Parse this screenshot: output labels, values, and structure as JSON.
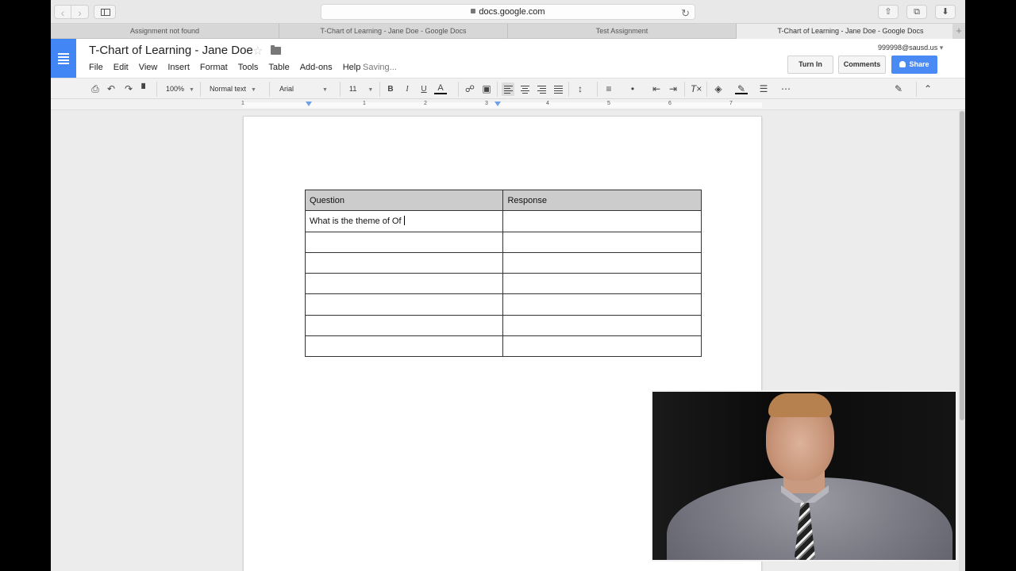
{
  "browser": {
    "url": "docs.google.com",
    "tabs": [
      {
        "title": "Assignment not found"
      },
      {
        "title": "T-Chart of Learning - Jane Doe - Google Docs"
      },
      {
        "title": "Test Assignment"
      },
      {
        "title": "T-Chart of Learning - Jane Doe - Google Docs"
      }
    ],
    "new_tab_symbol": "+"
  },
  "docs": {
    "title": "T-Chart of Learning - Jane Doe",
    "menu": [
      "File",
      "Edit",
      "View",
      "Insert",
      "Format",
      "Tools",
      "Table",
      "Add-ons",
      "Help"
    ],
    "status": "Saving...",
    "account": "999998@sausd.us",
    "turn_in_label": "Turn In",
    "comments_label": "Comments",
    "share_label": "Share",
    "brand_color": "#4285f4"
  },
  "toolbar": {
    "zoom": "100%",
    "style": "Normal text",
    "font": "Arial",
    "size": "11",
    "bold": "B",
    "italic": "I",
    "underline": "U",
    "text_color": "A"
  },
  "ruler": {
    "numbers": [
      "1",
      "1",
      "2",
      "3",
      "4",
      "5",
      "6",
      "7"
    ]
  },
  "table": {
    "headers": [
      "Question",
      "Response"
    ],
    "rows": [
      [
        "What is the theme of Of",
        ""
      ],
      [
        "",
        ""
      ],
      [
        "",
        ""
      ],
      [
        "",
        ""
      ],
      [
        "",
        ""
      ],
      [
        "",
        ""
      ],
      [
        "",
        ""
      ]
    ],
    "header_bg": "#cccccc"
  }
}
